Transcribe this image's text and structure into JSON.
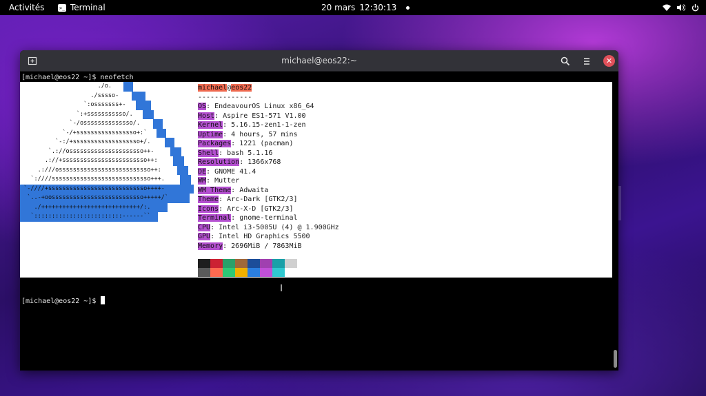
{
  "topbar": {
    "activities": "Activités",
    "app_name": "Terminal",
    "date": "20 mars",
    "time": "12:30:13",
    "tray_icons": [
      "wifi-icon",
      "volume-icon",
      "power-icon"
    ]
  },
  "window": {
    "title": "michael@eos22:~",
    "buttons": [
      "new-tab-icon",
      "search-icon",
      "hamburger-menu-icon",
      "close-icon"
    ]
  },
  "terminal": {
    "prompt": "[michael@eos22 ~]$",
    "command": "neofetch",
    "prompt2": "[michael@eos22 ~]$"
  },
  "logo": {
    "lines": [
      "                      ./o.",
      "                    ./sssso-",
      "                  `:osssssss+-",
      "                `:+sssssssssso/.",
      "              `-/ossssssssssssso/.",
      "            `-/+sssssssssssssssso+:`",
      "          `-:/+sssssssssssssssssso+/.",
      "        `.://osssssssssssssssssssso++-",
      "       .://+ssssssssssssssssssssssso++:",
      "     .:///ossssssssssssssssssssssssso++:",
      "   `:////ssssssssssssssssssssssssssso+++.",
      " `-////+ssssssssssssssssssssssssssso++++-",
      "  `..-+oossssssssssssssssssssssssso+++++/`",
      "    ./++++++++++++++++++++++++++++/:.",
      "   `:::::::::::::::::::::::::------``"
    ]
  },
  "info": {
    "user": "michael",
    "at": "@",
    "host": "eos22",
    "separator": "-------------",
    "rows": [
      {
        "key": "OS",
        "value": ": EndeavourOS Linux x86_64"
      },
      {
        "key": "Host",
        "value": ": Aspire ES1-571 V1.00"
      },
      {
        "key": "Kernel",
        "value": ": 5.16.15-zen1-1-zen"
      },
      {
        "key": "Uptime",
        "value": ": 4 hours, 57 mins"
      },
      {
        "key": "Packages",
        "value": ": 1221 (pacman)"
      },
      {
        "key": "Shell",
        "value": ": bash 5.1.16"
      },
      {
        "key": "Resolution",
        "value": ": 1366x768"
      },
      {
        "key": "DE",
        "value": ": GNOME 41.4"
      },
      {
        "key": "WM",
        "value": ": Mutter"
      },
      {
        "key": "WM Theme",
        "value": ": Adwaita"
      },
      {
        "key": "Theme",
        "value": ": Arc-Dark [GTK2/3]"
      },
      {
        "key": "Icons",
        "value": ": Arc-X-D [GTK2/3]"
      },
      {
        "key": "Terminal",
        "value": ": gnome-terminal"
      },
      {
        "key": "CPU",
        "value": ": Intel i3-5005U (4) @ 1.900GHz"
      },
      {
        "key": "GPU",
        "value": ": Intel HD Graphics 5500"
      },
      {
        "key": "Memory",
        "value": ": 2696MiB / 7863MiB"
      }
    ]
  },
  "palette": {
    "row1": [
      "#1e1e1e",
      "#cc2233",
      "#2aa06a",
      "#a0683a",
      "#1c4d99",
      "#a040b0",
      "#1aa0a8",
      "#d0d0d0"
    ],
    "row2": [
      "#5a5a5a",
      "#ff6a50",
      "#2ec876",
      "#f0b000",
      "#2b7ee0",
      "#c050d8",
      "#30c8d0",
      "#ffffff"
    ]
  }
}
